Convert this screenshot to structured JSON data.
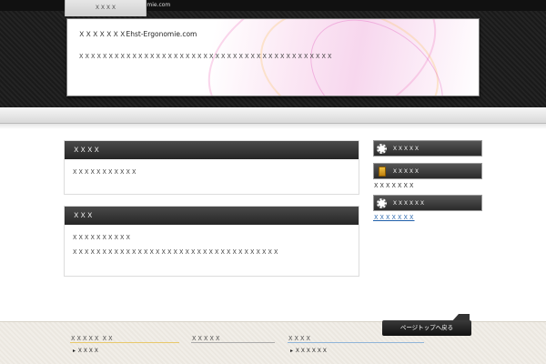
{
  "topbar": {
    "text": "ＸＸＸＸＸＸＸＸEhst-Ergonomie.com"
  },
  "header": {
    "site_title": "ＸＸＸＸＸＸＸEhst-Ergonomie.com",
    "description": "ＸＸＸＸＸＸＸＸＸＸＸＸＸＸＸＸＸＸＸＸＸＸＸＸＸＸＸＸＸＸＸＸＸＸＸＸＸＸＸＸＸＸＸ"
  },
  "nav": {
    "items": [
      {
        "label": "ＸＸＸＸ"
      }
    ]
  },
  "main": {
    "boxes": [
      {
        "title": "ＸＸＸＸ",
        "lines": [
          "ＸＸＸＸＸＸＸＸＸＸＸ"
        ]
      },
      {
        "title": "ＸＸＸ",
        "lines": [
          "ＸＸＸＸＸＸＸＸＸＸ",
          "ＸＸＸＸＸＸＸＸＸＸＸＸＸＸＸＸＸＸＸＸＸＸＸＸＸＸＸＸＸＸＸＸＸＸＸ"
        ]
      }
    ]
  },
  "sidebar": {
    "widgets": [
      {
        "title": "ＸＸＸＸＸ",
        "icon": "gear-icon"
      },
      {
        "title": "ＸＸＸＸＸ",
        "icon": "folder-icon",
        "text": "ＸＸＸＸＸＸＸ"
      },
      {
        "title": "ＸＸＸＸＸＸ",
        "icon": "gear-icon",
        "link": "ＸＸＸＸＸＸＸ"
      }
    ]
  },
  "footer": {
    "columns": [
      {
        "title": "ＸＸＸＸＸ ＸＸ",
        "item": "ＸＸＸＸ",
        "line_color": "#e8c86a"
      },
      {
        "title": "ＸＸＸＸＸ",
        "line_color": "#aaaaaa"
      },
      {
        "title": "ＸＸＸＸ",
        "item": "ＸＸＸＸＸＸ",
        "line_color": "#8fb4d8"
      }
    ],
    "pagetop_label": "ページトップへ戻る"
  }
}
